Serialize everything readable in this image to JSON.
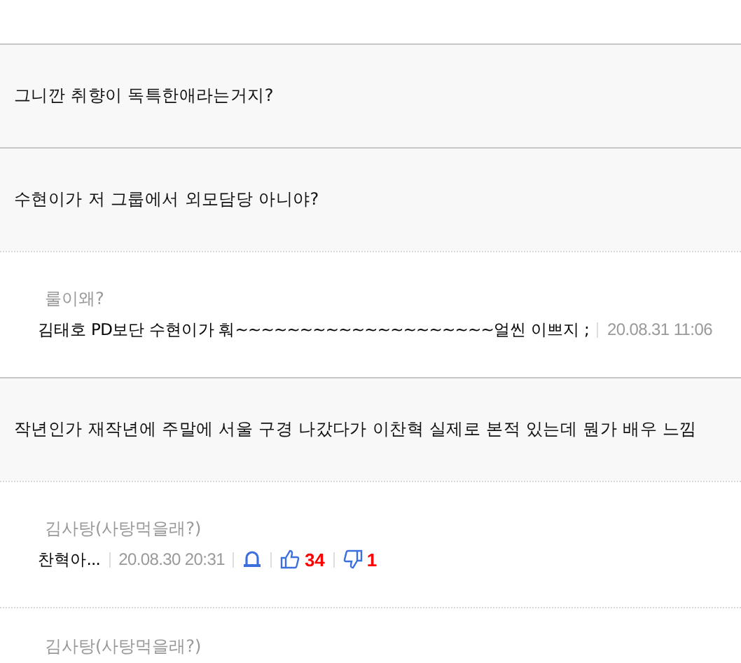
{
  "comments": [
    {
      "kind": "post",
      "text": "그니깐 취향이 독특한애라는거지?"
    },
    {
      "kind": "post",
      "text": "수현이가 저 그룹에서 외모담당 아니야?"
    },
    {
      "kind": "reply",
      "nickname": "룰이왜?",
      "text": "김태호 PD보단 수현이가 훠~~~~~~~~~~~~~~~~~~~~얼씬 이쁘지 ;",
      "date": "20.08.31 11:06"
    },
    {
      "kind": "post",
      "text": "작년인가 재작년에 주말에 서울 구경 나갔다가 이찬혁 실제로 본적 있는데 뭔가 배우 느낌"
    },
    {
      "kind": "reply",
      "nickname": "김사탕(사탕먹을래?)",
      "text": "찬혁아...",
      "date": "20.08.30 20:31",
      "likes": "34",
      "dislikes": "1"
    },
    {
      "kind": "reply",
      "nickname": "김사탕(사탕먹을래?)"
    }
  ]
}
